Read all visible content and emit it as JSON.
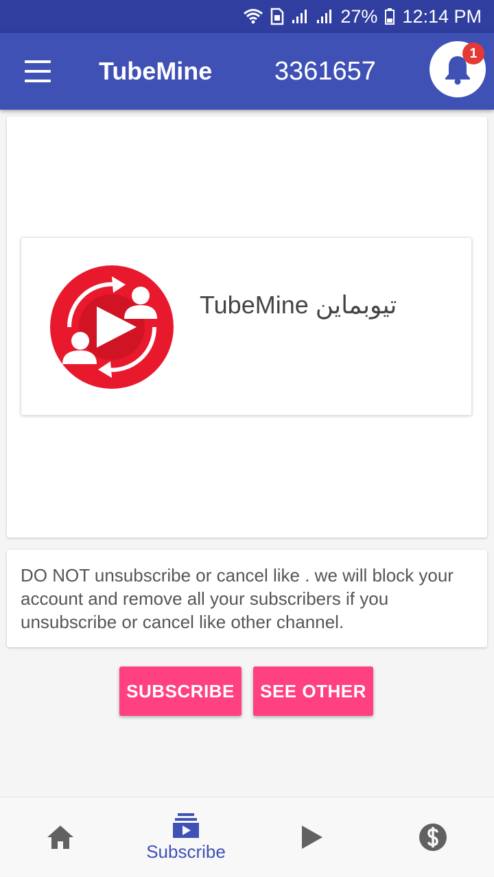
{
  "status_bar": {
    "battery": "27%",
    "time": "12:14 PM",
    "icons": [
      "wifi-icon",
      "sim-icon",
      "signal-icon",
      "signal-icon",
      "battery-icon"
    ]
  },
  "app_bar": {
    "title": "TubeMine",
    "balance": "3361657",
    "notification_count": "1",
    "icons": [
      "menu-icon",
      "bell-icon"
    ]
  },
  "channel": {
    "name": "TubeMine تیوبماین",
    "logo_icon": "tubemine-logo-icon"
  },
  "warning": {
    "text": "DO NOT unsubscribe or cancel like . we will block your account and remove all your subscribers if you unsubscribe or cancel like other channel."
  },
  "actions": {
    "subscribe_label": "SUBSCRIBE",
    "see_other_label": "SEE OTHER"
  },
  "bottom_nav": {
    "subscribe_label": "Subscribe",
    "items": [
      "home-icon",
      "subscriptions-icon",
      "play-icon",
      "dollar-icon"
    ]
  },
  "colors": {
    "status_bar": "#303f9f",
    "app_bar": "#3f51b5",
    "accent": "#ff4081",
    "logo_red": "#e8192c",
    "nav_active": "#3f51b5",
    "nav_inactive": "#616161"
  }
}
